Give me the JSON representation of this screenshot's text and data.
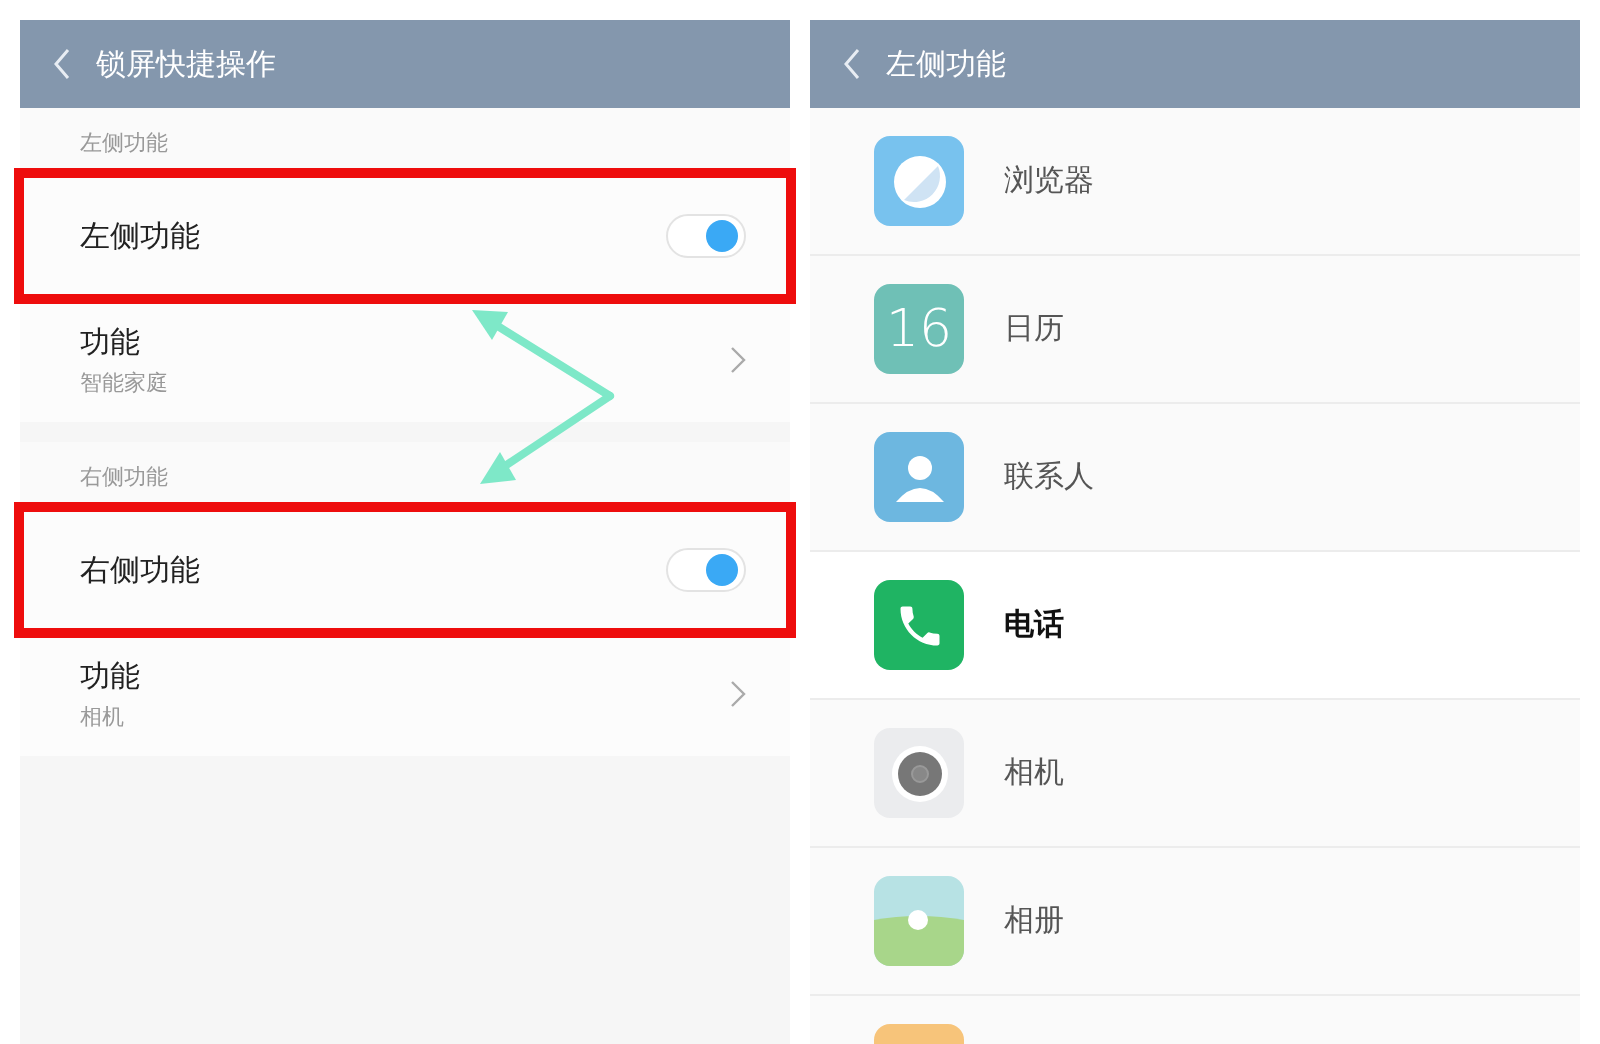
{
  "left_screen": {
    "title": "锁屏快捷操作",
    "sections": [
      {
        "header": "左侧功能",
        "rows": [
          {
            "kind": "toggle",
            "label": "左侧功能",
            "on": true,
            "highlighted": true
          },
          {
            "kind": "link",
            "label": "功能",
            "value": "智能家庭",
            "highlighted": false
          }
        ]
      },
      {
        "header": "右侧功能",
        "rows": [
          {
            "kind": "toggle",
            "label": "右侧功能",
            "on": true,
            "highlighted": true
          },
          {
            "kind": "link",
            "label": "功能",
            "value": "相机",
            "highlighted": false
          }
        ]
      }
    ]
  },
  "right_screen": {
    "title": "左侧功能",
    "apps": [
      {
        "kind": "browser",
        "label": "浏览器",
        "selected": false
      },
      {
        "kind": "calendar",
        "label": "日历",
        "icon_text": "16",
        "selected": false
      },
      {
        "kind": "contacts",
        "label": "联系人",
        "selected": false
      },
      {
        "kind": "phone",
        "label": "电话",
        "selected": true
      },
      {
        "kind": "camera",
        "label": "相机",
        "selected": false
      },
      {
        "kind": "gallery",
        "label": "相册",
        "selected": false
      },
      {
        "kind": "notes"
      }
    ]
  }
}
